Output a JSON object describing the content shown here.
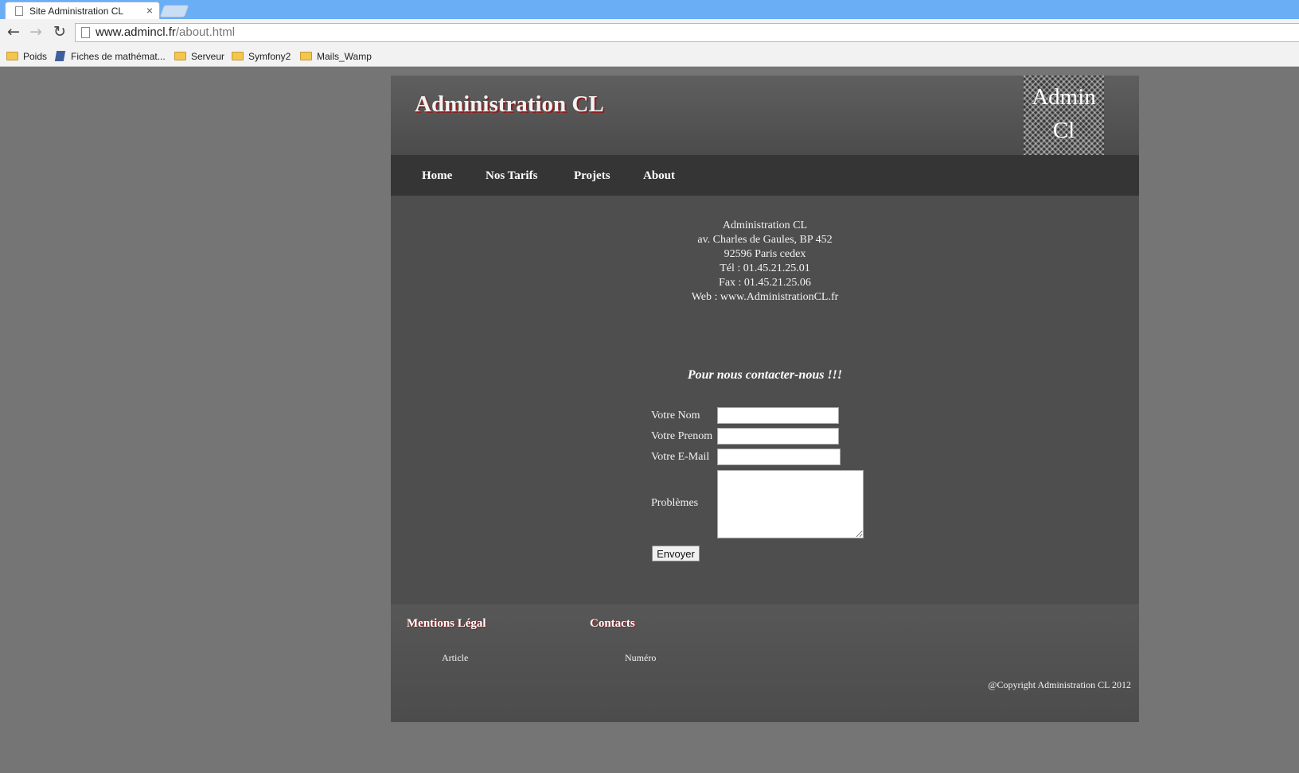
{
  "browser": {
    "tab_title": "Site Administration CL",
    "tab_close": "×",
    "url_host": "www.admincl.fr",
    "url_path": "/about.html",
    "bookmarks": [
      "Poids",
      "Fiches de mathémat...",
      "Serveur",
      "Symfony2",
      "Mails_Wamp"
    ]
  },
  "header": {
    "title": "Administration CL",
    "logo_line1": "Admin",
    "logo_line2": "Cl"
  },
  "nav": [
    "Home",
    "Nos Tarifs",
    "Projets",
    "About"
  ],
  "address": {
    "company": "Administration CL",
    "street": "av. Charles de Gaules, BP 452",
    "city": "92596 Paris cedex",
    "tel": "Tél : 01.45.21.25.01",
    "fax": "Fax : 01.45.21.25.06",
    "web": "Web : www.AdministrationCL.fr"
  },
  "form": {
    "heading": "Pour nous contacter-nous !!!",
    "nom_label": "Votre Nom",
    "prenom_label": "Votre Prenom",
    "email_label": "Votre E-Mail",
    "problemes_label": "Problèmes",
    "nom_value": "",
    "prenom_value": "",
    "email_value": "",
    "problemes_value": "",
    "submit_label": "Envoyer"
  },
  "footer": {
    "legal_heading": "Mentions Légal",
    "legal_link": "Article",
    "contacts_heading": "Contacts",
    "contacts_link": "Numéro",
    "copyright": "@Copyright Administration CL 2012"
  }
}
